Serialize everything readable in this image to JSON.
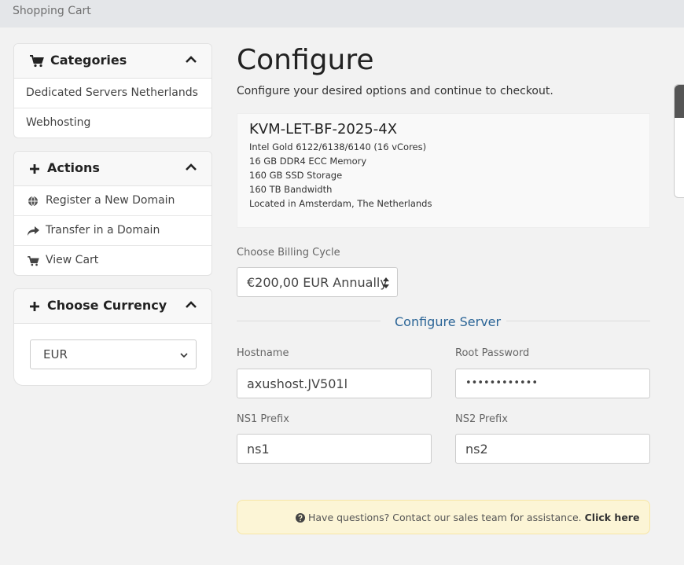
{
  "header": {
    "breadcrumb": "Shopping Cart"
  },
  "sidebar": {
    "categories": {
      "title": "Categories",
      "items": [
        "Dedicated Servers Netherlands",
        "Webhosting"
      ]
    },
    "actions": {
      "title": "Actions",
      "items": [
        {
          "label": "Register a New Domain",
          "icon": "globe-icon"
        },
        {
          "label": "Transfer in a Domain",
          "icon": "share-arrow-icon"
        },
        {
          "label": "View Cart",
          "icon": "cart-icon"
        }
      ]
    },
    "currency": {
      "title": "Choose Currency",
      "selected": "EUR"
    }
  },
  "main": {
    "title": "Configure",
    "subtitle": "Configure your desired options and continue to checkout.",
    "product": {
      "name": "KVM-LET-BF-2025-4X",
      "specs": [
        "Intel Gold 6122/6138/6140 (16 vCores)",
        "16 GB DDR4 ECC Memory",
        "160 GB SSD Storage",
        "160 TB Bandwidth",
        "Located in Amsterdam, The Netherlands"
      ]
    },
    "billing": {
      "label": "Choose Billing Cycle",
      "selected": "€200,00 EUR Annually"
    },
    "configure_server": {
      "title": "Configure Server",
      "hostname": {
        "label": "Hostname",
        "value": "axushost.JV501l"
      },
      "root_password": {
        "label": "Root Password",
        "value": "••••••••••••"
      },
      "ns1": {
        "label": "NS1 Prefix",
        "value": "ns1"
      },
      "ns2": {
        "label": "NS2 Prefix",
        "value": "ns2"
      }
    },
    "help": {
      "text": "Have questions? Contact our sales team for assistance.",
      "link": "Click here"
    }
  },
  "colors": {
    "accent_link": "#2a6496",
    "alert_bg": "#fcf5d6"
  }
}
